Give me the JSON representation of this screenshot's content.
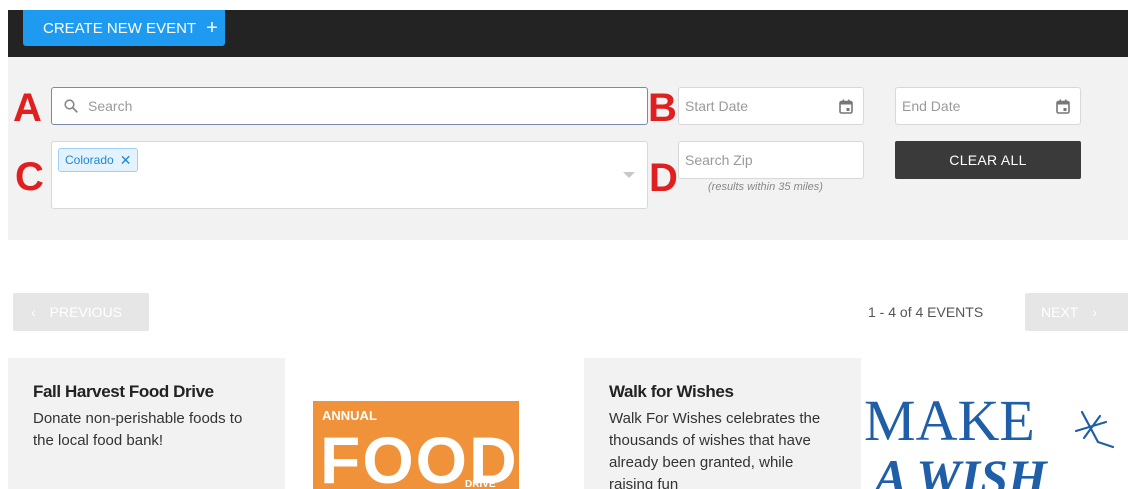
{
  "header": {
    "create_label": "CREATE NEW EVENT",
    "create_icon": "plus-icon"
  },
  "markers": {
    "a": "A",
    "b": "B",
    "c": "C",
    "d": "D"
  },
  "filters": {
    "search_placeholder": "Search",
    "start_date_placeholder": "Start Date",
    "end_date_placeholder": "End Date",
    "state_tag": "Colorado",
    "zip_placeholder": "Search Zip",
    "zip_hint": "(results within 35 miles)",
    "clear_label": "CLEAR ALL"
  },
  "pagination": {
    "prev_label": "PREVIOUS",
    "count": "1 - 4 of 4 EVENTS",
    "next_label": "NEXT"
  },
  "events": [
    {
      "title": "Fall Harvest Food Drive",
      "description": "Donate non-perishable foods to the local food bank!",
      "image_text": [
        "ANNUAL",
        "FOOD",
        "DRIVE"
      ]
    },
    {
      "title": "Walk for Wishes",
      "description": "Walk For Wishes celebrates the thousands of wishes that have already been granted, while raising fun",
      "image_text": [
        "MAKE",
        "A WISH"
      ]
    }
  ],
  "colors": {
    "accent": "#1e9bf0",
    "marker": "#e02020",
    "dark": "#3a3a3a",
    "food_orange": "#f0923a",
    "wish_blue": "#1f5fa8"
  }
}
